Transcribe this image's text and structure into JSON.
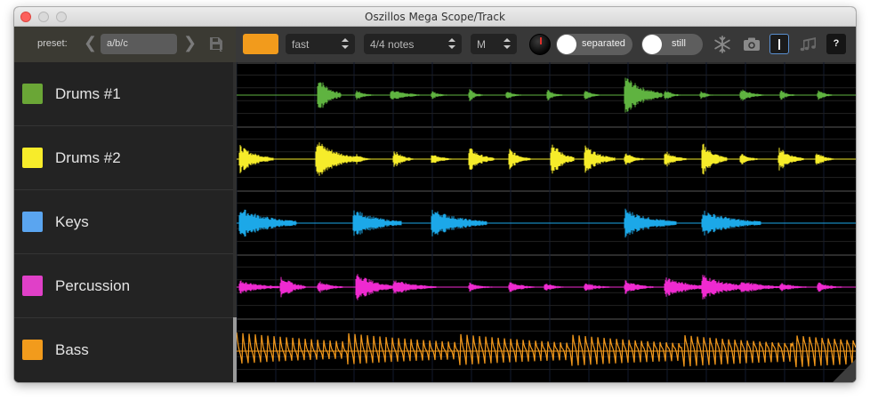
{
  "window": {
    "title": "Oszillos Mega Scope/Track"
  },
  "toolbar": {
    "preset_label": "preset:",
    "preset_value": "a/b/c",
    "track_color": "#f29b1c",
    "speed": "fast",
    "sync": "4/4 notes",
    "channel_mode": "M",
    "layout_toggle": "separated",
    "motion_toggle": "still",
    "help_label": "?"
  },
  "tracks": [
    {
      "name": "Drums #1",
      "color": "#6aa636"
    },
    {
      "name": "Drums #2",
      "color": "#f7ec2a"
    },
    {
      "name": "Keys",
      "color": "#5aa5f0"
    },
    {
      "name": "Percussion",
      "color": "#e040c8"
    },
    {
      "name": "Bass",
      "color": "#f29b1c"
    }
  ],
  "icons": {
    "prev": "chevron-left-icon",
    "next": "chevron-right-icon",
    "save": "save-preset-icon",
    "freeze": "snowflake-icon",
    "snapshot": "camera-icon",
    "notes": "music-notes-icon"
  }
}
